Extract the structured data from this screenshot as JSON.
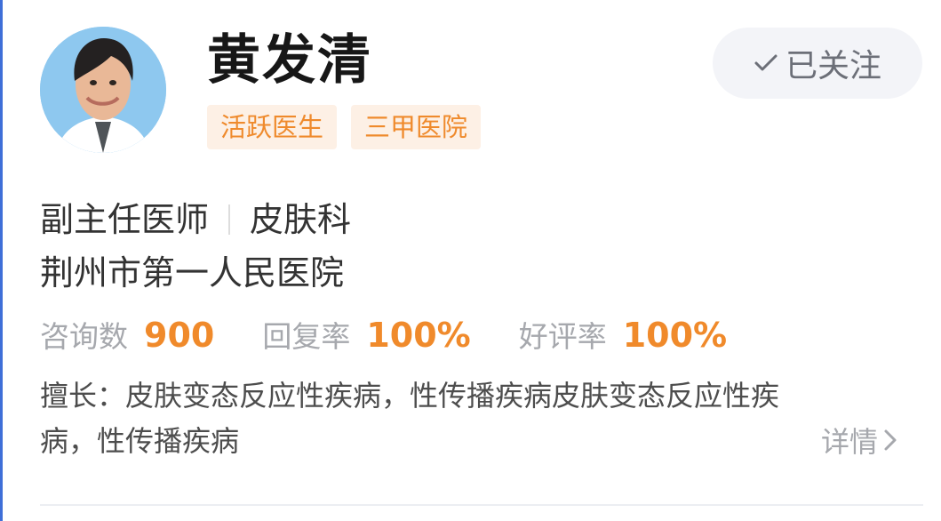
{
  "doctor": {
    "name": "黄发清",
    "tags": [
      "活跃医生",
      "三甲医院"
    ],
    "title": "副主任医师",
    "department": "皮肤科",
    "hospital": "荆州市第一人民医院"
  },
  "follow_button": {
    "label": "已关注",
    "icon": "check-icon"
  },
  "stats": [
    {
      "label": "咨询数",
      "value": "900"
    },
    {
      "label": "回复率",
      "value": "100%"
    },
    {
      "label": "好评率",
      "value": "100%"
    }
  ],
  "speciality": "擅长：皮肤变态反应性疾病，性传播疾病皮肤变态反应性疾病，性传播疾病",
  "details_link": {
    "label": "详情",
    "icon": "chevron-right-icon"
  },
  "colors": {
    "accent_orange": "#f08a2b",
    "tag_background": "#fdf0e5",
    "button_background": "#f3f4f8"
  }
}
